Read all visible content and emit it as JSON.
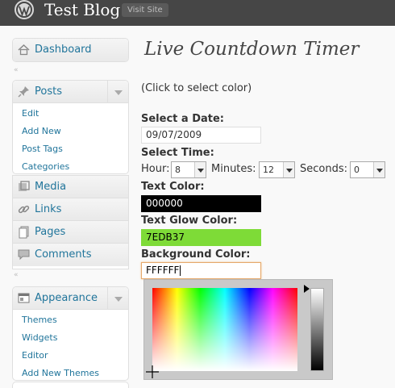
{
  "header": {
    "site_title": "Test Blog",
    "visit_site": "Visit Site",
    "bg_color": "#464646"
  },
  "sidebar": {
    "dashboard": {
      "label": "Dashboard",
      "icon": "home-icon"
    },
    "posts": {
      "label": "Posts",
      "icon": "pushpin-icon",
      "items": [
        "Edit",
        "Add New",
        "Post Tags",
        "Categories"
      ]
    },
    "media": {
      "label": "Media",
      "icon": "media-icon"
    },
    "links": {
      "label": "Links",
      "icon": "link-icon"
    },
    "pages": {
      "label": "Pages",
      "icon": "pages-icon"
    },
    "comments": {
      "label": "Comments",
      "icon": "comments-icon"
    },
    "appearance": {
      "label": "Appearance",
      "icon": "appearance-icon",
      "items": [
        "Themes",
        "Widgets",
        "Editor",
        "Add New Themes"
      ]
    },
    "collapse_glyph": "«"
  },
  "main": {
    "title": "Live Countdown Timer",
    "hint": "(Click to select color)",
    "select_date": {
      "label": "Select a Date:",
      "value": "09/07/2009"
    },
    "select_time": {
      "label": "Select Time:",
      "hour_label": "Hour:",
      "hour_value": "8",
      "minutes_label": "Minutes:",
      "minutes_value": "12",
      "seconds_label": "Seconds:",
      "seconds_value": "0"
    },
    "text_color": {
      "label": "Text Color:",
      "value": "000000",
      "color": "#000000"
    },
    "text_glow_color": {
      "label": "Text Glow Color:",
      "value": "7EDB37",
      "color": "#7EDB37"
    },
    "background_color": {
      "label": "Background Color:",
      "value": "FFFFFF",
      "color": "#FFFFFF"
    }
  },
  "colors": {
    "link": "#21759b",
    "focus_border": "#e6a96b"
  }
}
